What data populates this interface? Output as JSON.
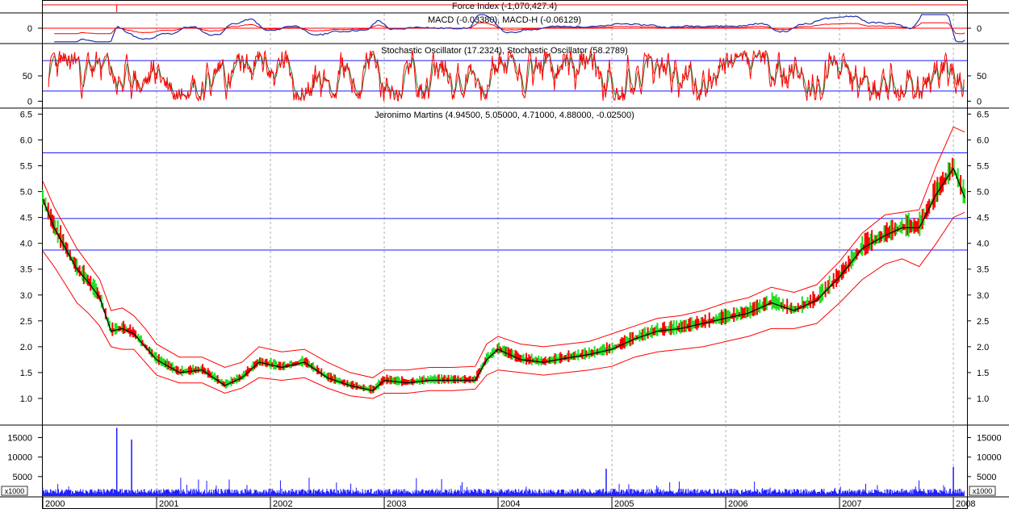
{
  "chart_data": [
    {
      "type": "line",
      "panel": "force-index",
      "title": "Force Index (-1,070,427.4)",
      "series": [
        {
          "name": "Force Index",
          "color": "#ff0000",
          "last": -1070427.4
        }
      ]
    },
    {
      "type": "line",
      "panel": "macd",
      "title": "MACD (-0.03380), MACD-H (-0.06129)",
      "ylim": [
        -0.3,
        0.3
      ],
      "yticks": [
        0
      ],
      "series": [
        {
          "name": "MACD",
          "color": "#1f2fb0",
          "last": -0.0338
        },
        {
          "name": "MACD-H",
          "color": "#ff0000",
          "last": -0.06129
        }
      ]
    },
    {
      "type": "line",
      "panel": "stochastic",
      "title": "Stochastic Oscillator (17.2324), Stochastic Oscillator (58.2789)",
      "ylim": [
        0,
        100
      ],
      "yticks": [
        0,
        50
      ],
      "reference_lines": [
        20,
        80
      ],
      "series": [
        {
          "name": "Stochastic Oscillator",
          "color": "#ff0000",
          "last": 17.2324
        },
        {
          "name": "Stochastic Oscillator",
          "color": "#2e7d32",
          "last": 58.2789
        }
      ]
    },
    {
      "type": "line",
      "panel": "price",
      "title": "Jeronimo Martins (4.94500, 5.05000, 4.71000, 4.88000, -0.02500)",
      "ylim": [
        0.5,
        6.6
      ],
      "yticks": [
        1.0,
        1.5,
        2.0,
        2.5,
        3.0,
        3.5,
        4.0,
        4.5,
        5.0,
        5.5,
        6.0,
        6.5
      ],
      "horizontal_lines": [
        3.87,
        4.48,
        5.75
      ],
      "x_labels": [
        "2000",
        "2001",
        "2002",
        "2003",
        "2004",
        "2005",
        "2006",
        "2007",
        "2008"
      ],
      "series": [
        {
          "name": "Price",
          "color": "#000000",
          "x": [
            2000.0,
            2000.1,
            2000.2,
            2000.3,
            2000.4,
            2000.5,
            2000.6,
            2000.7,
            2000.8,
            2000.9,
            2001.0,
            2001.2,
            2001.4,
            2001.6,
            2001.75,
            2001.9,
            2002.1,
            2002.3,
            2002.5,
            2002.7,
            2002.9,
            2003.0,
            2003.2,
            2003.4,
            2003.6,
            2003.8,
            2003.9,
            2004.0,
            2004.2,
            2004.4,
            2004.6,
            2004.8,
            2005.0,
            2005.2,
            2005.4,
            2005.6,
            2005.8,
            2006.0,
            2006.2,
            2006.4,
            2006.6,
            2006.8,
            2007.0,
            2007.2,
            2007.4,
            2007.55,
            2007.7,
            2007.85,
            2008.0,
            2008.1
          ],
          "y": [
            4.85,
            4.3,
            3.9,
            3.5,
            3.25,
            2.95,
            2.3,
            2.35,
            2.25,
            2.0,
            1.75,
            1.5,
            1.55,
            1.25,
            1.4,
            1.7,
            1.6,
            1.7,
            1.4,
            1.25,
            1.15,
            1.35,
            1.3,
            1.35,
            1.35,
            1.35,
            1.75,
            1.95,
            1.75,
            1.7,
            1.78,
            1.85,
            1.95,
            2.15,
            2.3,
            2.35,
            2.45,
            2.55,
            2.65,
            2.85,
            2.7,
            2.9,
            3.35,
            3.9,
            4.15,
            4.3,
            4.3,
            4.95,
            5.45,
            4.88
          ]
        },
        {
          "name": "Upper band",
          "color": "#ff0000",
          "x": [
            2000.0,
            2000.1,
            2000.2,
            2000.3,
            2000.4,
            2000.5,
            2000.6,
            2000.7,
            2000.8,
            2000.9,
            2001.0,
            2001.2,
            2001.4,
            2001.6,
            2001.75,
            2001.9,
            2002.1,
            2002.3,
            2002.5,
            2002.7,
            2002.9,
            2003.0,
            2003.2,
            2003.4,
            2003.6,
            2003.8,
            2003.9,
            2004.0,
            2004.2,
            2004.4,
            2004.6,
            2004.8,
            2005.0,
            2005.2,
            2005.4,
            2005.6,
            2005.8,
            2006.0,
            2006.2,
            2006.4,
            2006.6,
            2006.8,
            2007.0,
            2007.2,
            2007.4,
            2007.55,
            2007.7,
            2007.85,
            2008.0,
            2008.1
          ],
          "y": [
            5.2,
            4.7,
            4.3,
            3.9,
            3.6,
            3.3,
            2.7,
            2.75,
            2.6,
            2.35,
            2.05,
            1.8,
            1.8,
            1.6,
            1.7,
            2.0,
            1.9,
            1.95,
            1.7,
            1.5,
            1.4,
            1.55,
            1.55,
            1.6,
            1.6,
            1.62,
            2.05,
            2.2,
            2.05,
            2.0,
            2.05,
            2.1,
            2.25,
            2.4,
            2.55,
            2.6,
            2.7,
            2.85,
            2.95,
            3.15,
            3.05,
            3.2,
            3.65,
            4.2,
            4.55,
            4.6,
            4.65,
            5.5,
            6.25,
            6.15
          ]
        },
        {
          "name": "Lower band",
          "color": "#ff0000",
          "x": [
            2000.0,
            2000.1,
            2000.2,
            2000.3,
            2000.4,
            2000.5,
            2000.6,
            2000.7,
            2000.8,
            2000.9,
            2001.0,
            2001.2,
            2001.4,
            2001.6,
            2001.75,
            2001.9,
            2002.1,
            2002.3,
            2002.5,
            2002.7,
            2002.9,
            2003.0,
            2003.2,
            2003.4,
            2003.6,
            2003.8,
            2003.9,
            2004.0,
            2004.2,
            2004.4,
            2004.6,
            2004.8,
            2005.0,
            2005.2,
            2005.4,
            2005.6,
            2005.8,
            2006.0,
            2006.2,
            2006.4,
            2006.6,
            2006.8,
            2007.0,
            2007.2,
            2007.4,
            2007.55,
            2007.7,
            2007.85,
            2008.0,
            2008.1
          ],
          "y": [
            3.85,
            3.55,
            3.2,
            2.85,
            2.65,
            2.4,
            2.0,
            1.95,
            1.95,
            1.7,
            1.45,
            1.3,
            1.3,
            1.1,
            1.2,
            1.4,
            1.35,
            1.4,
            1.2,
            1.05,
            1.0,
            1.1,
            1.1,
            1.15,
            1.15,
            1.18,
            1.45,
            1.55,
            1.5,
            1.45,
            1.5,
            1.55,
            1.62,
            1.8,
            1.9,
            1.95,
            2.0,
            2.1,
            2.2,
            2.35,
            2.35,
            2.45,
            2.85,
            3.3,
            3.6,
            3.7,
            3.55,
            4.0,
            4.5,
            4.6
          ]
        }
      ]
    },
    {
      "type": "bar",
      "panel": "volume",
      "ylim": [
        0,
        18000
      ],
      "yticks": [
        5000,
        10000,
        15000
      ],
      "unit_label": "x1000",
      "series": [
        {
          "name": "Volume",
          "color": "#1a1aff",
          "spikes": [
            {
              "x": 2000.65,
              "y": 17500
            },
            {
              "x": 2000.78,
              "y": 14500
            },
            {
              "x": 2004.95,
              "y": 7000
            },
            {
              "x": 2008.0,
              "y": 7500
            }
          ]
        }
      ]
    }
  ]
}
